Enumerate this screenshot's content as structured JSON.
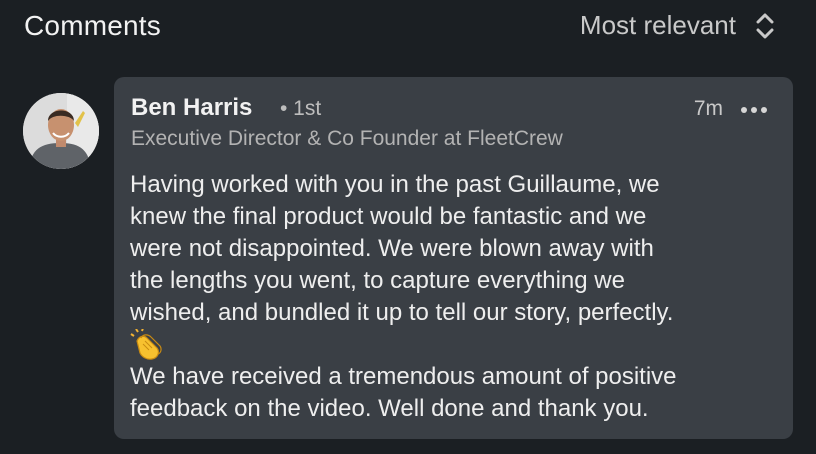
{
  "header": {
    "title": "Comments",
    "sort_label": "Most relevant"
  },
  "comment": {
    "author_name": "Ben Harris",
    "degree": "• 1st",
    "timestamp": "7m",
    "headline": "Executive Director & Co Founder at FleetCrew",
    "body_lines": [
      "Having worked with you in the past Guillaume, we",
      "knew the final product would be fantastic and we",
      "were not disappointed. We were blown away with",
      "the lengths you went, to capture everything we",
      "wished, and bundled it up to tell our story, perfectly."
    ],
    "body_lines_after": [
      "We have received a tremendous amount of positive",
      "feedback on the video. Well done and thank you."
    ]
  },
  "icons": {
    "sort": "chevron-up-down-icon",
    "more": "ellipsis-icon",
    "clap": "clapping-hands-emoji"
  },
  "colors": {
    "background": "#1b1f23",
    "card": "#3a3f45",
    "text_primary": "#eeeeee",
    "text_secondary": "#b3b3b3"
  }
}
